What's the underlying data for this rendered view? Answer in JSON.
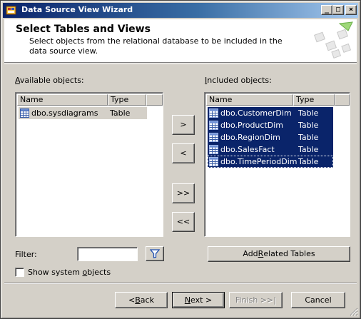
{
  "window": {
    "title": "Data Source View Wizard",
    "controls": {
      "minimize": "_",
      "maximize": "□",
      "close": "×"
    }
  },
  "header": {
    "title": "Select Tables and Views",
    "subtitle": "Select objects from the relational database to be included in the data source view."
  },
  "available": {
    "label_pre": "",
    "label_accel": "A",
    "label_post": "vailable objects:",
    "columns": [
      "Name",
      "Type"
    ],
    "rows": [
      {
        "name": "dbo.sysdiagrams",
        "type": "Table"
      }
    ]
  },
  "included": {
    "label_pre": "",
    "label_accel": "I",
    "label_post": "ncluded objects:",
    "columns": [
      "Name",
      "Type"
    ],
    "rows": [
      {
        "name": "dbo.CustomerDim",
        "type": "Table"
      },
      {
        "name": "dbo.ProductDim",
        "type": "Table"
      },
      {
        "name": "dbo.RegionDim",
        "type": "Table"
      },
      {
        "name": "dbo.SalesFact",
        "type": "Table"
      },
      {
        "name": "dbo.TimePeriodDim",
        "type": "Table"
      }
    ]
  },
  "transfer": {
    "add": ">",
    "remove": "<",
    "add_all": ">>",
    "remove_all": "<<"
  },
  "filter": {
    "label": "Filter:",
    "value": "",
    "icon": "filter-funnel-icon"
  },
  "add_related": {
    "pre": "Add ",
    "accel": "R",
    "post": "elated Tables"
  },
  "show_system": {
    "pre": "Show system ",
    "accel": "o",
    "post": "bjects",
    "checked": false
  },
  "footer": {
    "back_pre": "< ",
    "back_accel": "B",
    "back_post": "ack",
    "next_accel": "N",
    "next_post": "ext >",
    "finish": "Finish >>|",
    "cancel": "Cancel"
  },
  "colors": {
    "selection": "#0a246a",
    "face": "#d4d0c8",
    "title_start": "#0a246a",
    "title_end": "#a6caf0"
  }
}
